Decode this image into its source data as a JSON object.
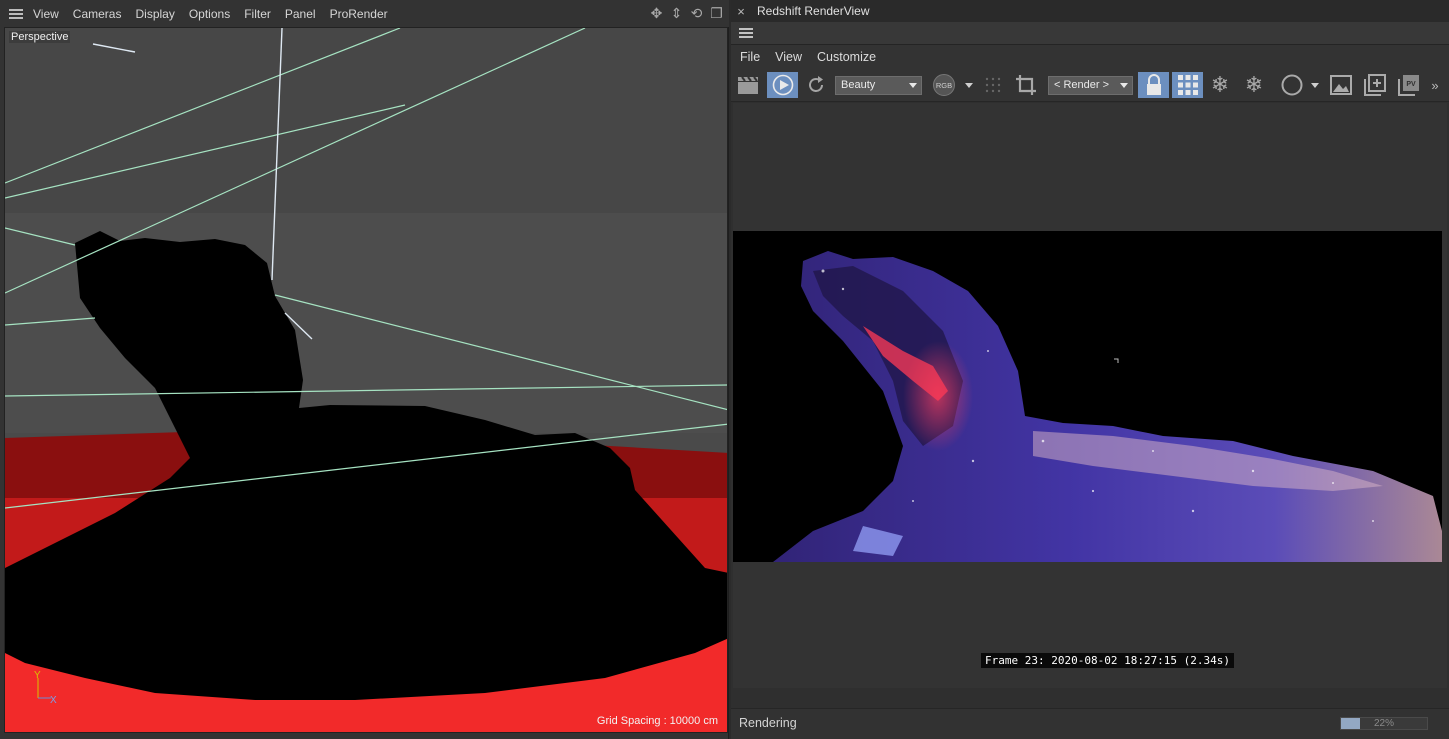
{
  "viewport_menu": {
    "items": [
      "View",
      "Cameras",
      "Display",
      "Options",
      "Filter",
      "Panel",
      "ProRender"
    ]
  },
  "viewport": {
    "camera_label": "Perspective",
    "grid_spacing": "Grid Spacing : 10000 cm",
    "axis_y": "Y",
    "axis_x": "X"
  },
  "render_view": {
    "title": "Redshift RenderView",
    "close_glyph": "×",
    "menu": [
      "File",
      "View",
      "Customize"
    ],
    "aov_dropdown": "Beauty",
    "rgb_badge": "RGB",
    "camera_dropdown": "< Render >",
    "frame_info": "Frame  23:  2020-08-02  18:27:15  (2.34s)",
    "status": "Rendering",
    "progress_label": "22%",
    "progress": 0.22,
    "overflow_glyph": "»"
  },
  "colors": {
    "active_button": "#6c8fbf",
    "viewport_floor": "#e02a2a",
    "guide_lines": "#a6e3c2"
  }
}
